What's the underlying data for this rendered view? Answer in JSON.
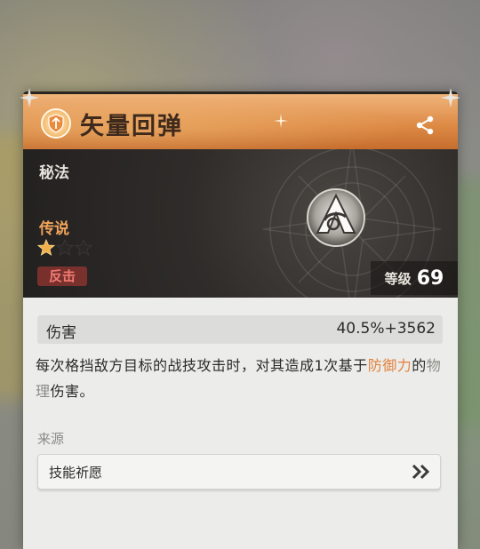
{
  "skill": {
    "title": "矢量回弹",
    "category": "秘法",
    "rarity": "传说",
    "stars": {
      "filled": 1,
      "total": 3
    },
    "tag": "反击",
    "level_label": "等级",
    "level_value": "69"
  },
  "stat": {
    "name": "伤害",
    "value": "40.5%+3562"
  },
  "description": {
    "part1": "每次格挡敌方目标的战技攻击时，对其造成1次基于",
    "highlight_defense": "防御力",
    "part2": "的",
    "highlight_physical": "物理",
    "part3": "伤害。"
  },
  "source": {
    "label": "来源",
    "item": "技能祈愿"
  },
  "icons": {
    "header": "skill-type-icon",
    "share": "share-icon",
    "emblem": "skill-emblem-icon",
    "more": "double-chevron-right-icon"
  },
  "colors": {
    "header_orange": "#dd8a45",
    "rarity_orange": "#f1a35a",
    "tag_red": "#f17b72",
    "highlight_orange": "#e2813c"
  }
}
